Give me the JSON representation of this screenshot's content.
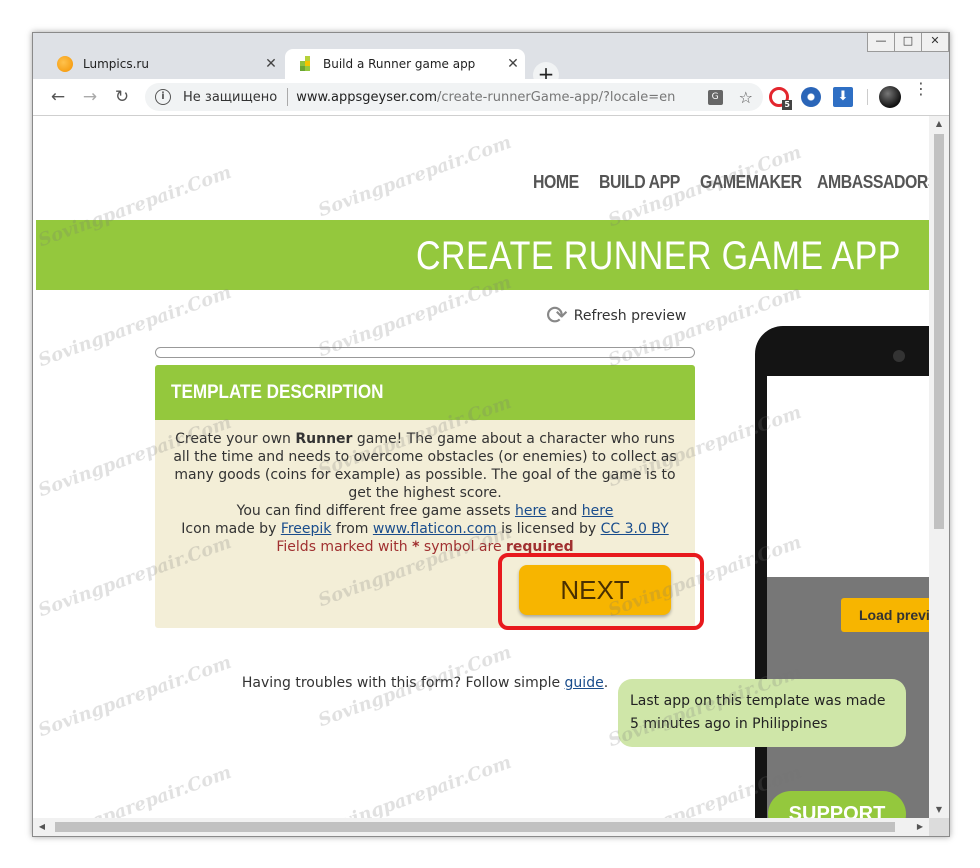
{
  "browser": {
    "window_controls": {
      "minimize": "—",
      "maximize": "□",
      "close": "✕"
    },
    "tabs": [
      {
        "title": "Lumpics.ru",
        "close": "✕",
        "active": false,
        "favicon": "orange-circle-icon"
      },
      {
        "title": "Build a Runner game app",
        "close": "✕",
        "active": true,
        "favicon": "appsgeyser-icon"
      }
    ],
    "new_tab": "+",
    "nav": {
      "back": "←",
      "forward": "→",
      "reload": "↻"
    },
    "omnibox": {
      "security_label": "Не защищено",
      "url_host": "www.appsgeyser.com",
      "url_path": "/create-runnerGame-app/?locale=en"
    },
    "extension_badge": "5",
    "menu": "⋮"
  },
  "site": {
    "nav_items": [
      "HOME",
      "BUILD APP",
      "GAMEMAKER",
      "AMBASSADORS"
    ],
    "hero_title": "CREATE RUNNER GAME APP",
    "refresh_preview": "Refresh preview",
    "template": {
      "heading": "TEMPLATE DESCRIPTION",
      "intro_pre": "Create your own ",
      "intro_bold": "Runner",
      "intro_post": " game! The game about a character who runs all the time and needs to overcome obstacles (or enemies) to collect as many goods (coins for example) as possible. The goal of the game is to get the highest score.",
      "assets_pre": "You can find different free game assets ",
      "assets_link1": "here",
      "assets_mid": " and ",
      "assets_link2": "here",
      "icon_pre": "Icon made by ",
      "icon_link_author": "Freepik",
      "icon_from": " from ",
      "icon_link_site": "www.flaticon.com",
      "icon_licensed": " is licensed by ",
      "icon_link_license": "CC 3.0 BY",
      "required_pre": "Fields marked with ",
      "required_star": "*",
      "required_mid": " symbol are ",
      "required_bold": "required"
    },
    "next_button": "NEXT",
    "troubles_pre": "Having troubles with this form? Follow simple ",
    "troubles_link": "guide",
    "troubles_post": ".",
    "load_preview_button": "Load preview",
    "last_app_line1": "Last app on this template was made",
    "last_app_line2": "5 minutes ago in Philippines",
    "support_button": "SUPPORT"
  },
  "watermark": "Sovingparepair.Com",
  "colors": {
    "brand_green": "#94c83d",
    "next_yellow": "#f7b500",
    "highlight_red": "#e8191d",
    "card_bg": "#f3eed7",
    "toast_bg": "#cfe6a8"
  }
}
